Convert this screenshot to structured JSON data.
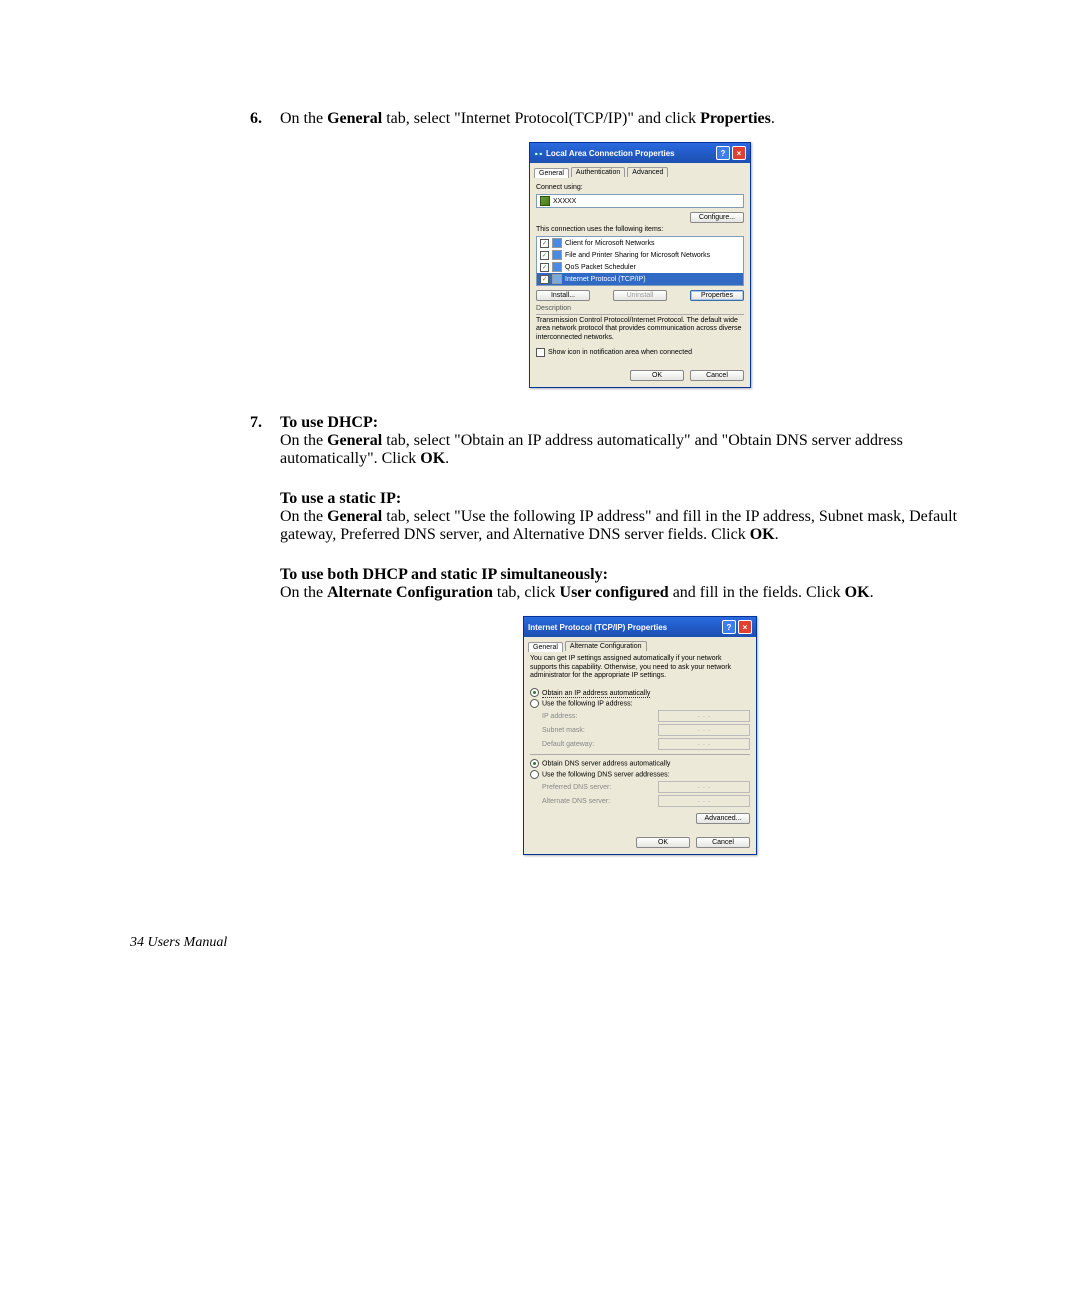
{
  "steps": {
    "s6": {
      "num": "6.",
      "text_pre": "On the ",
      "bold1": "General",
      "text_mid": " tab, select \"Internet Protocol(TCP/IP)\" and click ",
      "bold2": "Properties",
      "text_post": "."
    },
    "s7": {
      "num": "7.",
      "h1": "To use DHCP:",
      "p1_pre": "On the ",
      "p1_b1": "General",
      "p1_mid": " tab, select \"Obtain an IP address automatically\" and \"Obtain DNS server address automatically\". Click ",
      "p1_b2": "OK",
      "p1_post": ".",
      "h2": "To use a static IP:",
      "p2_pre": "On the ",
      "p2_b1": "General",
      "p2_mid": " tab, select \"Use the following IP address\" and fill in the IP address, Subnet mask, Default gateway, Preferred DNS server, and Alternative DNS server fields. Click ",
      "p2_b2": "OK",
      "p2_post": ".",
      "h3": "To use both DHCP and static IP simultaneously:",
      "p3_pre": "On the ",
      "p3_b1": "Alternate Configuration",
      "p3_mid": " tab, click ",
      "p3_b2": "User configured",
      "p3_mid2": " and fill in the fields. Click ",
      "p3_b3": "OK",
      "p3_post": "."
    }
  },
  "dialog1": {
    "title": "Local Area Connection Properties",
    "tabs": [
      "General",
      "Authentication",
      "Advanced"
    ],
    "connect_label": "Connect using:",
    "adapter": "XXXXX",
    "configure_btn": "Configure...",
    "uses_label": "This connection uses the following items:",
    "items": [
      {
        "checked": true,
        "label": "Client for Microsoft Networks"
      },
      {
        "checked": true,
        "label": "File and Printer Sharing for Microsoft Networks"
      },
      {
        "checked": true,
        "label": "QoS Packet Scheduler"
      },
      {
        "checked": true,
        "label": "Internet Protocol (TCP/IP)",
        "selected": true
      }
    ],
    "install_btn": "Install...",
    "uninstall_btn": "Uninstall",
    "properties_btn": "Properties",
    "desc_label": "Description",
    "desc_text": "Transmission Control Protocol/Internet Protocol. The default wide area network protocol that provides communication across diverse interconnected networks.",
    "show_icon": "Show icon in notification area when connected",
    "ok_btn": "OK",
    "cancel_btn": "Cancel"
  },
  "dialog2": {
    "title": "Internet Protocol (TCP/IP) Properties",
    "tabs": [
      "General",
      "Alternate Configuration"
    ],
    "intro": "You can get IP settings assigned automatically if your network supports this capability. Otherwise, you need to ask your network administrator for the appropriate IP settings.",
    "r1": "Obtain an IP address automatically",
    "r2": "Use the following IP address:",
    "f_ip": "IP address:",
    "f_mask": "Subnet mask:",
    "f_gw": "Default gateway:",
    "r3": "Obtain DNS server address automatically",
    "r4": "Use the following DNS server addresses:",
    "f_pdns": "Preferred DNS server:",
    "f_adns": "Alternate DNS server:",
    "advanced_btn": "Advanced...",
    "ok_btn": "OK",
    "cancel_btn": "Cancel"
  },
  "footer": "34  Users Manual"
}
